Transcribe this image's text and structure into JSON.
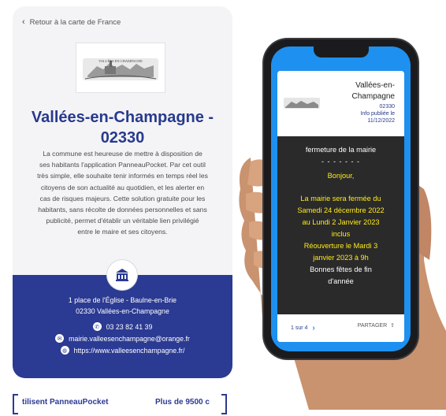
{
  "card": {
    "back_link": "Retour à la carte de France",
    "logo_text": "VALLÉES EN CHAMPAGNE",
    "title_line1": "Vallées-en-Champagne -",
    "title_line2": "02330",
    "description_lines": [
      "La commune est heureuse de mettre à disposition de",
      "ses habitants l'application PanneauPocket. Par cet outil",
      "très simple, elle souhaite tenir informés en temps réel les",
      "citoyens de son actualité au quotidien, et les alerter en",
      "cas de risques majeurs. Cette solution gratuite pour les",
      "habitants, sans récolte de données personnelles et sans",
      "publicité, permet d'établir un véritable lien privilégié",
      "entre le maire et ses citoyens."
    ],
    "address_line1": "1 place de l'Église - Baulne-en-Brie",
    "address_line2": "02330 Vallées-en-Champagne",
    "phone": "03 23 82 41 39",
    "email": "mairie.valleesenchampagne@orange.fr",
    "website": "https://www.valleesenchampagne.fr/"
  },
  "marquee": {
    "text1": "tilisent PanneauPocket",
    "text2": "Plus de 9500 c"
  },
  "phone_app": {
    "city_line1": "Vallées-en-",
    "city_line2": "Champagne",
    "postcode": "02330",
    "published_label": "Info publiée le",
    "published_date": "11/12/2022",
    "message_title": "fermeture de la mairie",
    "message_dashes": "- - - - - - -",
    "greeting": "Bonjour,",
    "body_lines": [
      "La mairie sera fermée du",
      "Samedi 24 décembre 2022",
      "au Lundi 2 Janvier 2023",
      "inclus",
      "Réouverture le Mardi 3",
      "janvier 2023 à 9h"
    ],
    "closing_lines": [
      "Bonnes fêtes de fin",
      "d'année"
    ],
    "pager": "1 sur 4",
    "share_label": "PARTAGER"
  },
  "colors": {
    "brand_blue": "#2b3a92",
    "title_blue": "#273a8d",
    "screen_blue": "#1e90ef",
    "message_yellow": "#ffeb1a",
    "message_bg": "#2a2a2a"
  },
  "icons": {
    "back": "chevron-left-icon",
    "mairie": "town-hall-icon",
    "phone": "phone-icon",
    "email": "mail-icon",
    "web": "globe-icon",
    "next": "chevron-right-icon",
    "share": "share-icon"
  }
}
